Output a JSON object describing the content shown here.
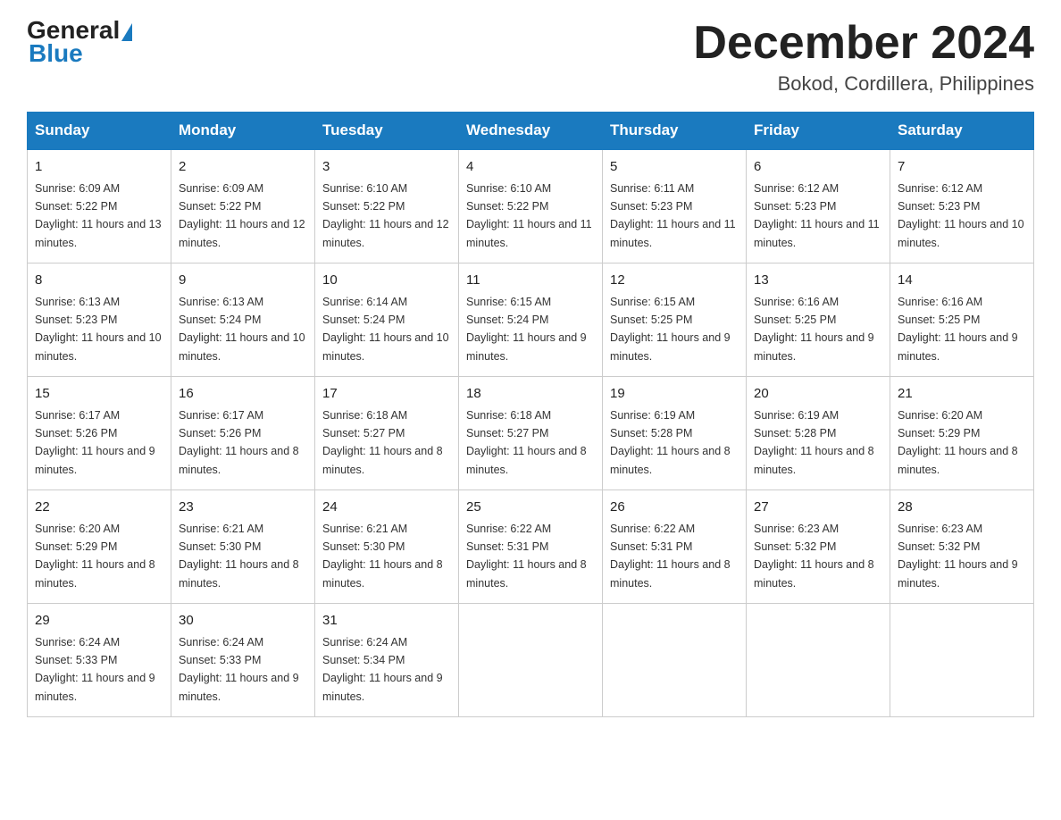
{
  "logo": {
    "general": "General",
    "blue": "Blue"
  },
  "title": "December 2024",
  "subtitle": "Bokod, Cordillera, Philippines",
  "weekdays": [
    "Sunday",
    "Monday",
    "Tuesday",
    "Wednesday",
    "Thursday",
    "Friday",
    "Saturday"
  ],
  "weeks": [
    [
      {
        "day": "1",
        "sunrise": "6:09 AM",
        "sunset": "5:22 PM",
        "daylight": "11 hours and 13 minutes."
      },
      {
        "day": "2",
        "sunrise": "6:09 AM",
        "sunset": "5:22 PM",
        "daylight": "11 hours and 12 minutes."
      },
      {
        "day": "3",
        "sunrise": "6:10 AM",
        "sunset": "5:22 PM",
        "daylight": "11 hours and 12 minutes."
      },
      {
        "day": "4",
        "sunrise": "6:10 AM",
        "sunset": "5:22 PM",
        "daylight": "11 hours and 11 minutes."
      },
      {
        "day": "5",
        "sunrise": "6:11 AM",
        "sunset": "5:23 PM",
        "daylight": "11 hours and 11 minutes."
      },
      {
        "day": "6",
        "sunrise": "6:12 AM",
        "sunset": "5:23 PM",
        "daylight": "11 hours and 11 minutes."
      },
      {
        "day": "7",
        "sunrise": "6:12 AM",
        "sunset": "5:23 PM",
        "daylight": "11 hours and 10 minutes."
      }
    ],
    [
      {
        "day": "8",
        "sunrise": "6:13 AM",
        "sunset": "5:23 PM",
        "daylight": "11 hours and 10 minutes."
      },
      {
        "day": "9",
        "sunrise": "6:13 AM",
        "sunset": "5:24 PM",
        "daylight": "11 hours and 10 minutes."
      },
      {
        "day": "10",
        "sunrise": "6:14 AM",
        "sunset": "5:24 PM",
        "daylight": "11 hours and 10 minutes."
      },
      {
        "day": "11",
        "sunrise": "6:15 AM",
        "sunset": "5:24 PM",
        "daylight": "11 hours and 9 minutes."
      },
      {
        "day": "12",
        "sunrise": "6:15 AM",
        "sunset": "5:25 PM",
        "daylight": "11 hours and 9 minutes."
      },
      {
        "day": "13",
        "sunrise": "6:16 AM",
        "sunset": "5:25 PM",
        "daylight": "11 hours and 9 minutes."
      },
      {
        "day": "14",
        "sunrise": "6:16 AM",
        "sunset": "5:25 PM",
        "daylight": "11 hours and 9 minutes."
      }
    ],
    [
      {
        "day": "15",
        "sunrise": "6:17 AM",
        "sunset": "5:26 PM",
        "daylight": "11 hours and 9 minutes."
      },
      {
        "day": "16",
        "sunrise": "6:17 AM",
        "sunset": "5:26 PM",
        "daylight": "11 hours and 8 minutes."
      },
      {
        "day": "17",
        "sunrise": "6:18 AM",
        "sunset": "5:27 PM",
        "daylight": "11 hours and 8 minutes."
      },
      {
        "day": "18",
        "sunrise": "6:18 AM",
        "sunset": "5:27 PM",
        "daylight": "11 hours and 8 minutes."
      },
      {
        "day": "19",
        "sunrise": "6:19 AM",
        "sunset": "5:28 PM",
        "daylight": "11 hours and 8 minutes."
      },
      {
        "day": "20",
        "sunrise": "6:19 AM",
        "sunset": "5:28 PM",
        "daylight": "11 hours and 8 minutes."
      },
      {
        "day": "21",
        "sunrise": "6:20 AM",
        "sunset": "5:29 PM",
        "daylight": "11 hours and 8 minutes."
      }
    ],
    [
      {
        "day": "22",
        "sunrise": "6:20 AM",
        "sunset": "5:29 PM",
        "daylight": "11 hours and 8 minutes."
      },
      {
        "day": "23",
        "sunrise": "6:21 AM",
        "sunset": "5:30 PM",
        "daylight": "11 hours and 8 minutes."
      },
      {
        "day": "24",
        "sunrise": "6:21 AM",
        "sunset": "5:30 PM",
        "daylight": "11 hours and 8 minutes."
      },
      {
        "day": "25",
        "sunrise": "6:22 AM",
        "sunset": "5:31 PM",
        "daylight": "11 hours and 8 minutes."
      },
      {
        "day": "26",
        "sunrise": "6:22 AM",
        "sunset": "5:31 PM",
        "daylight": "11 hours and 8 minutes."
      },
      {
        "day": "27",
        "sunrise": "6:23 AM",
        "sunset": "5:32 PM",
        "daylight": "11 hours and 8 minutes."
      },
      {
        "day": "28",
        "sunrise": "6:23 AM",
        "sunset": "5:32 PM",
        "daylight": "11 hours and 9 minutes."
      }
    ],
    [
      {
        "day": "29",
        "sunrise": "6:24 AM",
        "sunset": "5:33 PM",
        "daylight": "11 hours and 9 minutes."
      },
      {
        "day": "30",
        "sunrise": "6:24 AM",
        "sunset": "5:33 PM",
        "daylight": "11 hours and 9 minutes."
      },
      {
        "day": "31",
        "sunrise": "6:24 AM",
        "sunset": "5:34 PM",
        "daylight": "11 hours and 9 minutes."
      },
      null,
      null,
      null,
      null
    ]
  ]
}
